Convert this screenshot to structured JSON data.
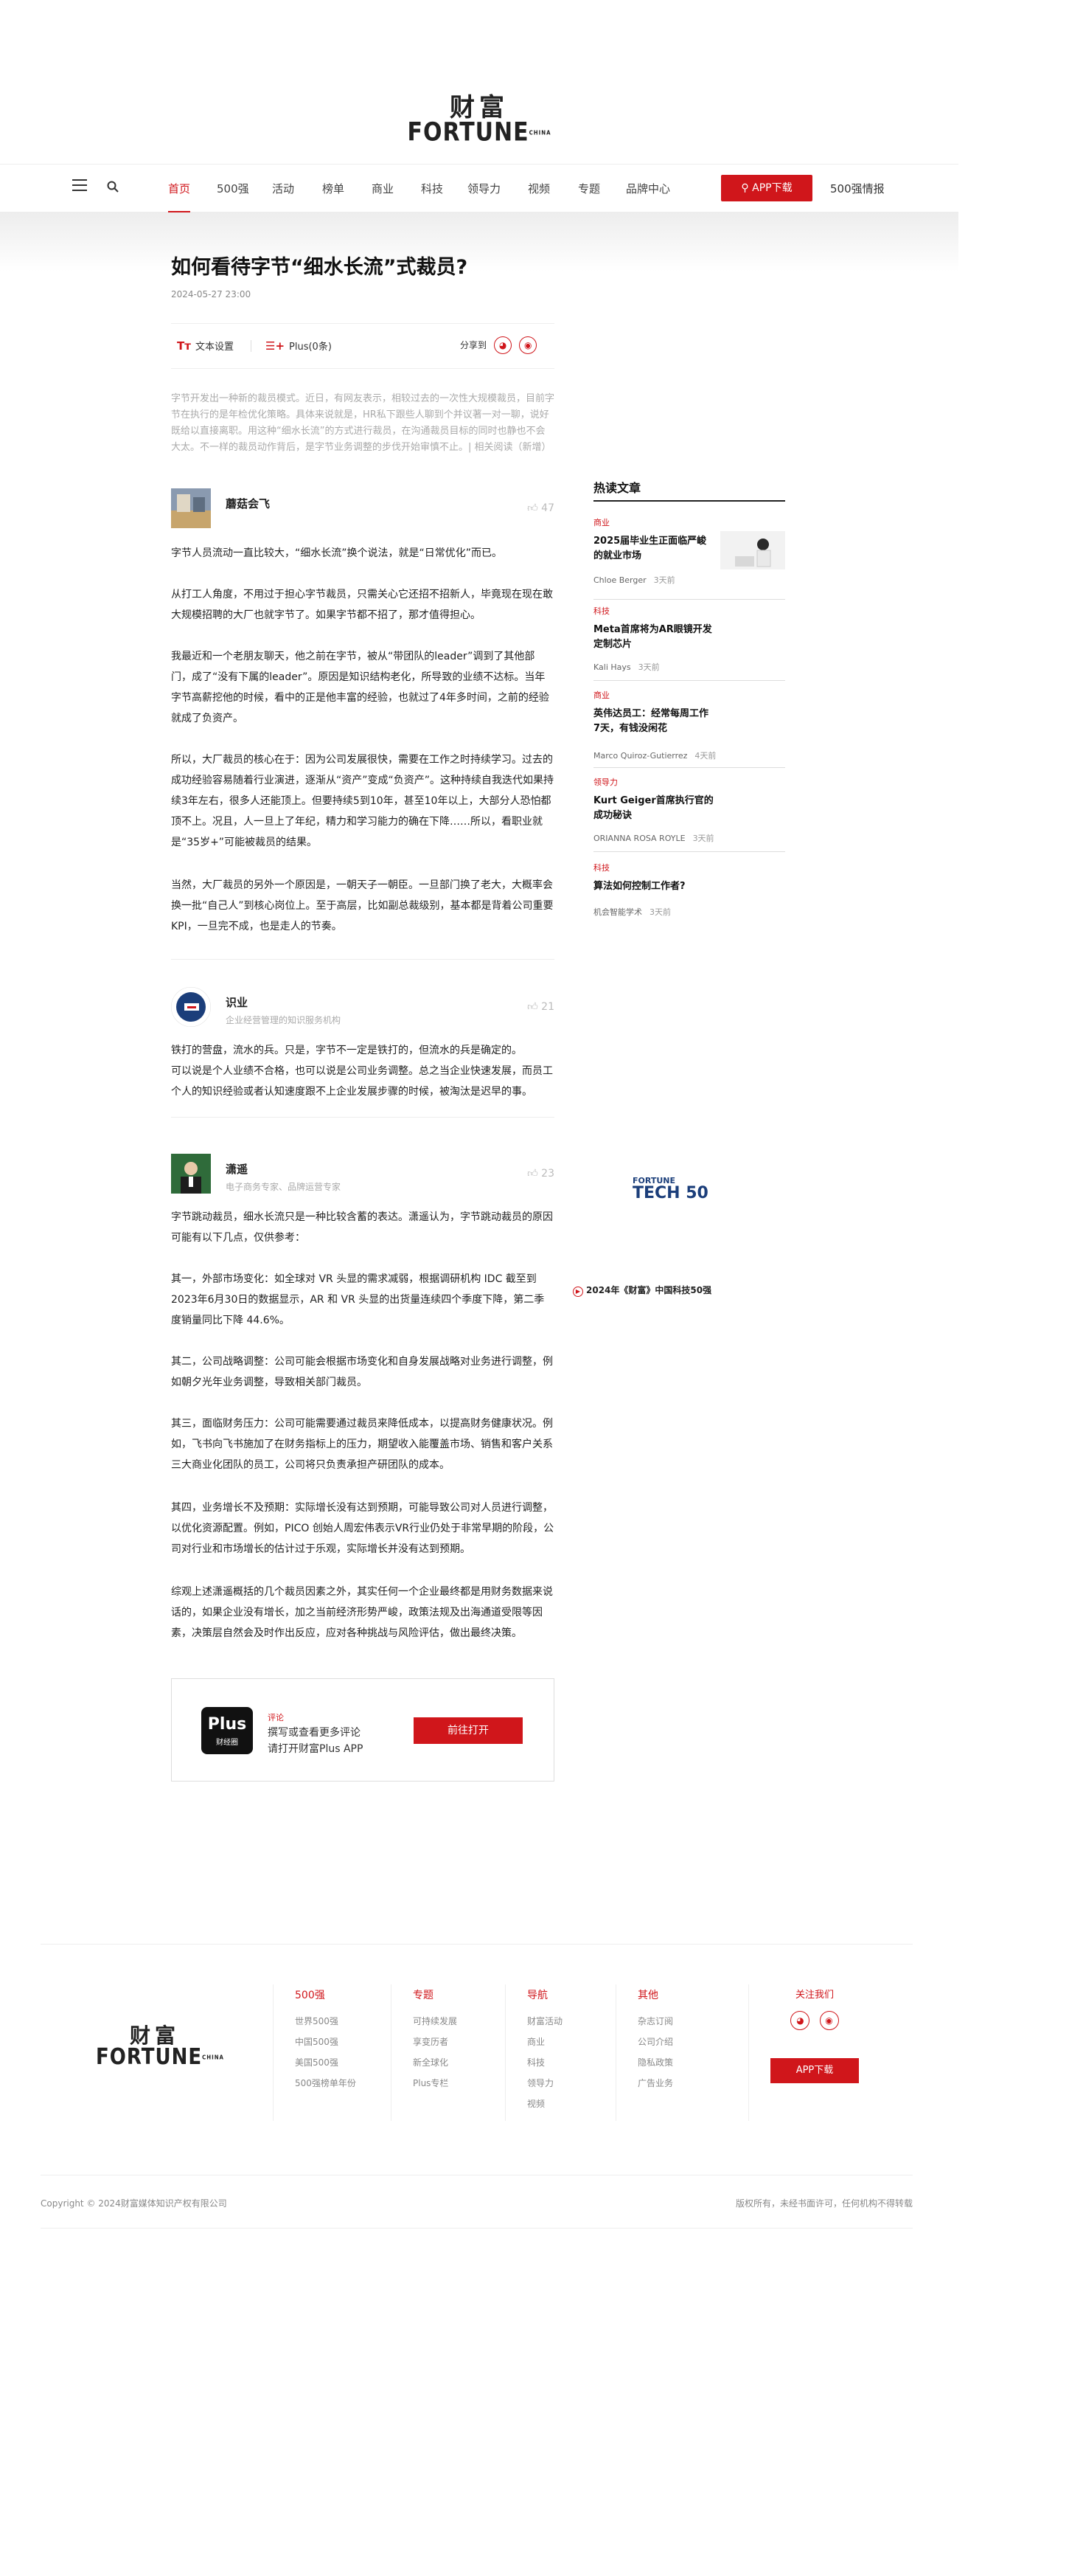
{
  "brand": {
    "logo_cn": "财富",
    "logo_en": "FORTUNE",
    "logo_suffix": "CHINA"
  },
  "nav": {
    "items": [
      "首页",
      "500强",
      "活动",
      "榜单",
      "商业",
      "科技",
      "领导力",
      "视频",
      "专题",
      "品牌中心"
    ],
    "active": "首页",
    "app_download": "APP下载",
    "intel": "500强情报"
  },
  "article": {
    "title": "如何看待字节“细水长流”式裁员?",
    "date": "2024-05-27 23:00",
    "text_settings": "文本设置",
    "plus_label": "Plus(0条)",
    "share_label": "分享到",
    "summary": "字节开发出一种新的裁员模式。近日，有网友表示，相较过去的一次性大规模裁员，目前字节在执行的是年检优化策略。具体来说就是，HR私下跟些人聊到个并议著一对一聊，说好既给以直接离职。用这种“细水长流”的方式进行裁员，在沟通裁员目标的同时也静也不会大太。不一样的裁员动作背后，是字节业务调整的步伐开始审慎不止。| 相关阅读（新增）"
  },
  "answers": [
    {
      "name": "蘑菇会飞",
      "desc": "",
      "likes": "47",
      "paras": [
        "字节人员流动一直比较大，“细水长流”换个说法，就是“日常优化”而已。",
        "从打工人角度，不用过于担心字节裁员，只需关心它还招不招新人，毕竟现在现在敢大规模招聘的大厂也就字节了。如果字节都不招了，那才值得担心。",
        "我最近和一个老朋友聊天，他之前在字节，被从“带团队的leader”调到了其他部门，成了“没有下属的leader”。原因是知识结构老化，所导致的业绩不达标。当年字节高薪挖他的时候，看中的正是他丰富的经验，也就过了4年多时间，之前的经验就成了负资产。",
        "所以，大厂裁员的核心在于：因为公司发展很快，需要在工作之时持续学习。过去的成功经验容易随着行业演进，逐渐从“资产”变成“负资产”。这种持续自我迭代如果持续3年左右，很多人还能顶上。但要持续5到10年，甚至10年以上，大部分人恐怕都顶不上。况且，人一旦上了年纪，精力和学习能力的确在下降……所以，看职业就是“35岁+”可能被裁员的结果。",
        "当然，大厂裁员的另外一个原因是，一朝天子一朝臣。一旦部门换了老大，大概率会换一批“自己人”到核心岗位上。至于高层，比如副总裁级别，基本都是背着公司重要KPI，一旦完不成，也是走人的节奏。"
      ]
    },
    {
      "name": "识业",
      "desc": "企业经营管理的知识服务机构",
      "likes": "21",
      "paras": [
        "铁打的营盘，流水的兵。只是，字节不一定是铁打的，但流水的兵是确定的。",
        "可以说是个人业绩不合格，也可以说是公司业务调整。总之当企业快速发展，而员工个人的知识经验或者认知速度跟不上企业发展步骤的时候，被淘汰是迟早的事。"
      ]
    },
    {
      "name": "潇遥",
      "desc": "电子商务专家、品牌运营专家",
      "likes": "23",
      "paras": [
        "字节跳动裁员，细水长流只是一种比较含蓄的表达。潇遥认为，字节跳动裁员的原因可能有以下几点，仅供参考：",
        "其一，外部市场变化：如全球对 VR 头显的需求减弱，根据调研机构 IDC 截至到2023年6月30日的数据显示，AR 和 VR 头显的出货量连续四个季度下降，第二季度销量同比下降 44.6%。",
        "其二，公司战略调整：公司可能会根据市场变化和自身发展战略对业务进行调整，例如朝夕光年业务调整，导致相关部门裁员。",
        "其三，面临财务压力：公司可能需要通过裁员来降低成本，以提高财务健康状况。例如，飞书向飞书施加了在财务指标上的压力，期望收入能覆盖市场、销售和客户关系三大商业化团队的员工，公司将只负责承担产研团队的成本。",
        "其四，业务增长不及预期：实际增长没有达到预期，可能导致公司对人员进行调整，以优化资源配置。例如，PICO 创始人周宏伟表示VR行业仍处于非常早期的阶段，公司对行业和市场增长的估计过于乐观，实际增长并没有达到预期。",
        "综观上述潇遥概括的几个裁员因素之外，其实任何一个企业最终都是用财务数据来说话的，如果企业没有增长，加之当前经济形势严峻，政策法规及出海通道受限等因素，决策层自然会及时作出反应，应对各种挑战与风险评估，做出最终决策。"
      ]
    }
  ],
  "plus_box": {
    "logo_text": "Plus",
    "logo_sub": "财经圈",
    "tag": "评论",
    "line1": "撰写或查看更多评论",
    "line2": "请打开财富Plus APP",
    "button": "前往打开"
  },
  "sidebar": {
    "title": "热读文章",
    "items": [
      {
        "cat": "商业",
        "title": "2025届毕业生正面临严峻的就业市场",
        "author": "Chloe Berger",
        "time": "3天前",
        "has_thumb": true
      },
      {
        "cat": "科技",
        "title": "Meta首席将为AR眼镜开发定制芯片",
        "author": "Kali Hays",
        "time": "3天前",
        "has_thumb": false
      },
      {
        "cat": "商业",
        "title": "英伟达员工：经常每周工作7天，有钱没闲花",
        "author": "Marco Quiroz-Gutierrez",
        "time": "4天前",
        "has_thumb": false
      },
      {
        "cat": "领导力",
        "title": "Kurt Geiger首席执行官的成功秘诀",
        "author": "ORIANNA ROSA ROYLE",
        "time": "3天前",
        "has_thumb": false
      },
      {
        "cat": "科技",
        "title": "算法如何控制工作者?",
        "author": "机会智能学术",
        "time": "3天前",
        "has_thumb": false
      }
    ],
    "ad_logo_top": "FORTUNE",
    "ad_logo_bottom": "TECH 50",
    "ad_caption": "2024年《财富》中国科技50强"
  },
  "footer": {
    "columns": [
      {
        "head": "500强",
        "links": [
          "世界500强",
          "中国500强",
          "美国500强",
          "500强榜单年份"
        ]
      },
      {
        "head": "专题",
        "links": [
          "可持续发展",
          "享变历者",
          "新全球化",
          "Plus专栏"
        ]
      },
      {
        "head": "导航",
        "links": [
          "财富活动",
          "商业",
          "科技",
          "领导力",
          "视频"
        ]
      },
      {
        "head": "其他",
        "links": [
          "杂志订阅",
          "公司介绍",
          "隐私政策",
          "广告业务"
        ]
      }
    ],
    "follow": "关注我们",
    "app_download": "APP下载",
    "copyright": "Copyright © 2024财富媒体知识产权有限公司",
    "rights": "版权所有，未经书面许可，任何机构不得转载"
  },
  "colors": {
    "accent": "#d0161b"
  }
}
